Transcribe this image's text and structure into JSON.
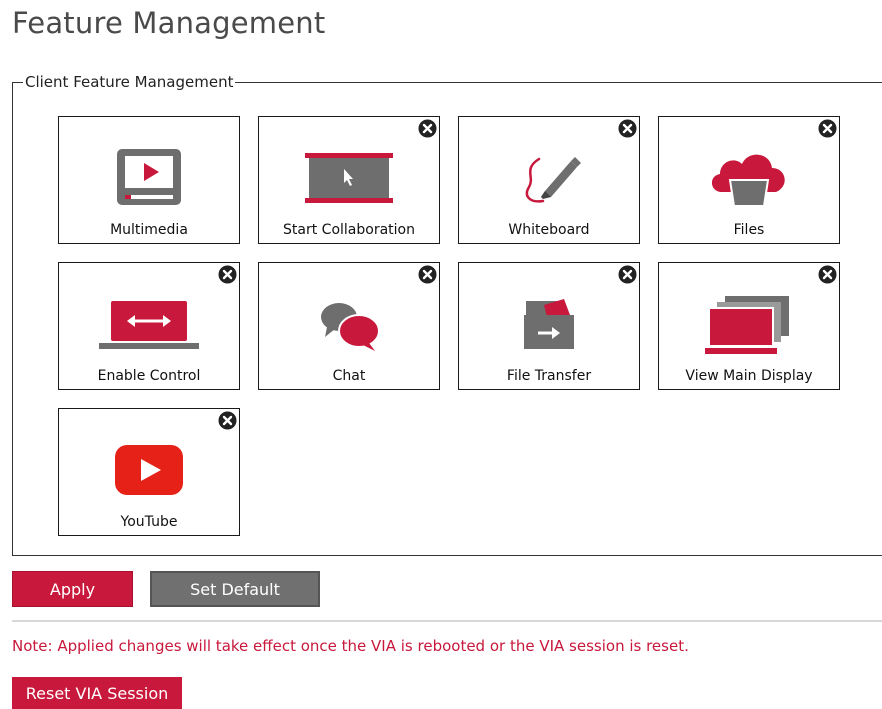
{
  "page": {
    "title": "Feature Management"
  },
  "group": {
    "legend": "Client Feature Management"
  },
  "features": [
    {
      "label": "Multimedia",
      "icon": "multimedia-icon",
      "removable": false
    },
    {
      "label": "Start Collaboration",
      "icon": "collaboration-icon",
      "removable": true
    },
    {
      "label": "Whiteboard",
      "icon": "whiteboard-icon",
      "removable": true
    },
    {
      "label": "Files",
      "icon": "cloud-files-icon",
      "removable": true
    },
    {
      "label": "Enable Control",
      "icon": "enable-control-icon",
      "removable": true
    },
    {
      "label": "Chat",
      "icon": "chat-icon",
      "removable": true
    },
    {
      "label": "File Transfer",
      "icon": "file-transfer-icon",
      "removable": true
    },
    {
      "label": "View Main Display",
      "icon": "view-main-display-icon",
      "removable": true
    },
    {
      "label": "YouTube",
      "icon": "youtube-icon",
      "removable": true
    }
  ],
  "actions": {
    "apply_label": "Apply",
    "default_label": "Set Default",
    "reset_label": "Reset VIA Session"
  },
  "note": "Note: Applied changes will take effect once the VIA is rebooted or the VIA session is reset.",
  "colors": {
    "accent": "#c8183c",
    "gray": "#707070",
    "icon_gray": "#6e6e6e"
  }
}
